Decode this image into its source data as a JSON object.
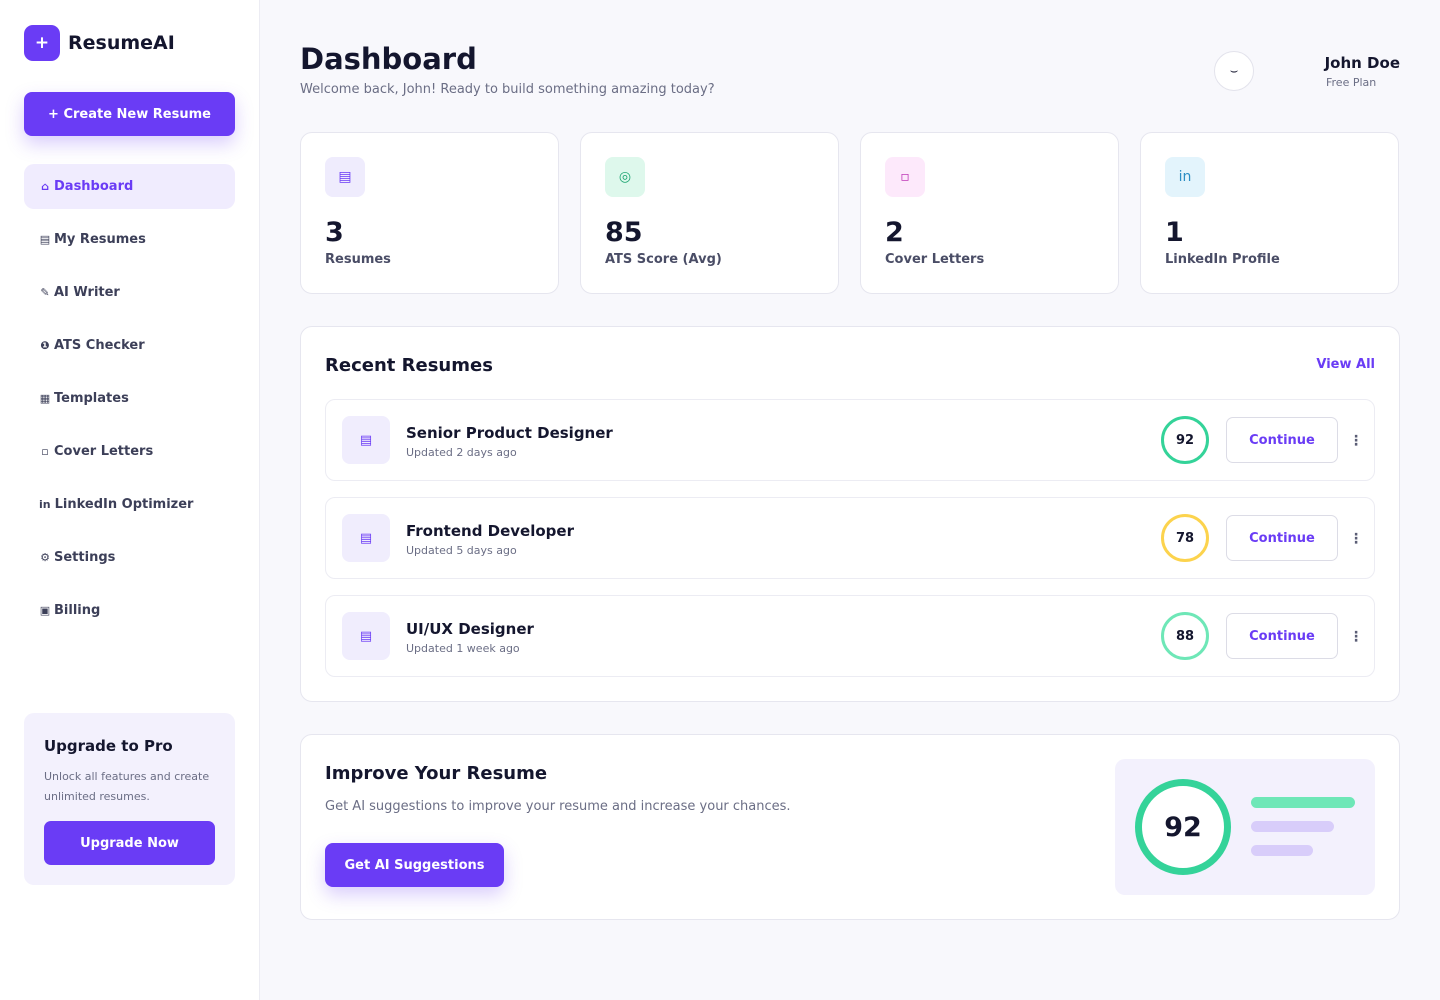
{
  "brand": {
    "logo_glyph": "+",
    "name": "ResumeAI",
    "accent": "#6a3cf5"
  },
  "sidebar": {
    "create_label": "+ Create New Resume",
    "items": [
      {
        "icon": "home-icon",
        "glyph": "⌂",
        "label": "Dashboard",
        "active": true
      },
      {
        "icon": "document-icon",
        "glyph": "▤",
        "label": "My Resumes"
      },
      {
        "icon": "pen-icon",
        "glyph": "✎",
        "label": "AI Writer"
      },
      {
        "icon": "check-circle-icon",
        "glyph": "❶",
        "label": "ATS Checker"
      },
      {
        "icon": "grid-icon",
        "glyph": "▦",
        "label": "Templates"
      },
      {
        "icon": "envelope-icon",
        "glyph": "▫",
        "label": "Cover Letters"
      },
      {
        "icon": "linkedin-icon",
        "glyph": "in",
        "label": "LinkedIn Optimizer"
      },
      {
        "icon": "gear-icon",
        "glyph": "⚙",
        "label": "Settings"
      },
      {
        "icon": "card-icon",
        "glyph": "▣",
        "label": "Billing"
      }
    ],
    "upgrade": {
      "title": "Upgrade to Pro",
      "text": "Unlock all features and create unlimited resumes.",
      "button": "Upgrade Now"
    }
  },
  "header": {
    "title": "Dashboard",
    "subtitle": "Welcome back, John! Ready to build something amazing today?",
    "avatar_glyph": "⌣",
    "user_name": "John Doe",
    "user_plan": "Free Plan"
  },
  "stats": [
    {
      "icon": "document-icon",
      "glyph": "▤",
      "value": "3",
      "label": "Resumes",
      "icon_bg": "#efecfd",
      "icon_color": "#6a3cf5"
    },
    {
      "icon": "target-icon",
      "glyph": "◎",
      "value": "85",
      "label": "ATS Score (Avg)",
      "icon_bg": "#def8ec",
      "icon_color": "#1ea672"
    },
    {
      "icon": "envelope-icon",
      "glyph": "▫",
      "value": "2",
      "label": "Cover Letters",
      "icon_bg": "#fde9fb",
      "icon_color": "#c03ab8"
    },
    {
      "icon": "linkedin-icon",
      "glyph": "in",
      "value": "1",
      "label": "LinkedIn Profile",
      "icon_bg": "#e3f4fc",
      "icon_color": "#2c8ec4"
    }
  ],
  "recent": {
    "title": "Recent Resumes",
    "view_all": "View All",
    "rows": [
      {
        "glyph": "▤",
        "title": "Senior Product Designer",
        "updated": "Updated 2 days ago",
        "score": "92",
        "ring_color": "#34d399",
        "action": "Continue",
        "menu": "⋮"
      },
      {
        "glyph": "▤",
        "title": "Frontend Developer",
        "updated": "Updated 5 days ago",
        "score": "78",
        "ring_color": "#fcd34d",
        "action": "Continue",
        "menu": "⋮"
      },
      {
        "glyph": "▤",
        "title": "UI/UX Designer",
        "updated": "Updated 1 week ago",
        "score": "88",
        "ring_color": "#6ee7b7",
        "action": "Continue",
        "menu": "⋮"
      }
    ]
  },
  "improve": {
    "title": "Improve Your Resume",
    "subtitle": "Get AI suggestions to improve your resume and increase your chances.",
    "button": "Get AI Suggestions",
    "score": "92",
    "ring_color": "#34d399",
    "bar_colors": [
      "#6ee7b7",
      "#d8cdfa",
      "#d8cdfa"
    ]
  }
}
